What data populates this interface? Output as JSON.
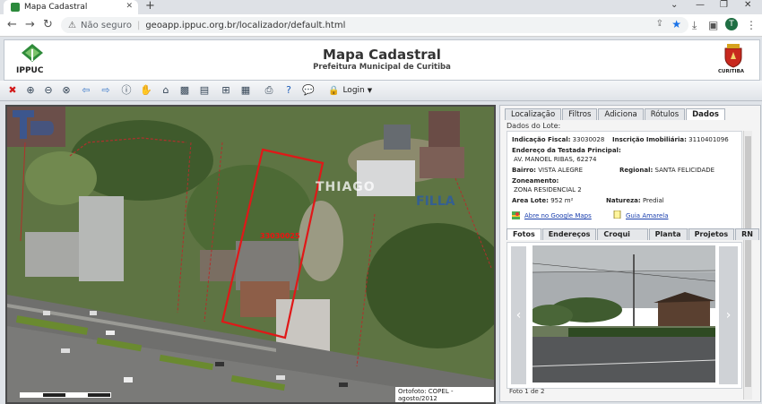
{
  "browser": {
    "tab_title": "Mapa Cadastral",
    "tab_close": "✕",
    "new_tab": "+",
    "security_label": "Não seguro",
    "url": "geoapp.ippuc.org.br/localizador/default.html",
    "profile_initial": "T"
  },
  "header": {
    "logo_text": "IPPUC",
    "title": "Mapa Cadastral",
    "subtitle": "Prefeitura Municipal de Curitiba",
    "city_label": "CURITIBA"
  },
  "toolbar": {
    "login_label": "Login"
  },
  "map": {
    "lot_label": "33030025",
    "watermark_name": "THIAGO",
    "watermark_brand": "FILLA",
    "credit": "Ortofoto: COPEL - agosto/2012"
  },
  "panel": {
    "tabs": [
      "Localização",
      "Filtros",
      "Adiciona",
      "Rótulos",
      "Dados"
    ],
    "active_tab": "Dados",
    "data_title": "Dados do Lote:",
    "indicacao_label": "Indicação Fiscal:",
    "indicacao_value": "33030028",
    "inscricao_label": "Inscrição Imobiliária:",
    "inscricao_value": "3110401096",
    "endereco_label": "Endereço da Testada Principal:",
    "endereco_value": "AV. MANOEL RIBAS, 62274",
    "bairro_label": "Bairro:",
    "bairro_value": "VISTA ALEGRE",
    "regional_label": "Regional:",
    "regional_value": "SANTA FELICIDADE",
    "zoneamento_label": "Zoneamento:",
    "zoneamento_value": "ZONA RESIDENCIAL 2",
    "area_label": "Area Lote:",
    "area_value": "952 m²",
    "natureza_label": "Natureza:",
    "natureza_value": "Predial",
    "maps_link": "Abre no Google Maps",
    "guia_link": "Guia Amarela",
    "photo_tabs": [
      "Fotos",
      "Endereços",
      "Croqui Foreiro",
      "Planta",
      "Projetos",
      "RN"
    ],
    "photo_prev": "‹",
    "photo_next": "›",
    "photo_count": "Foto 1 de 2"
  },
  "colors": {
    "accent_blue": "#1a73e8",
    "lot_outline": "#e01818",
    "link": "#1a3fae"
  }
}
